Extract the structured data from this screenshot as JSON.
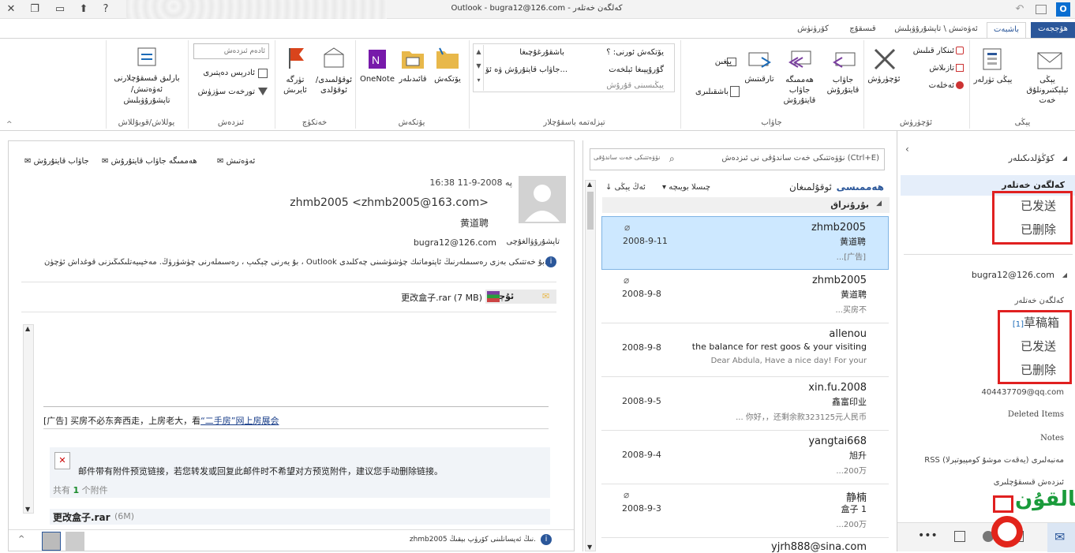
{
  "window": {
    "title": "Outlook - bugra12@126.com - كەلگەن خەتلەر",
    "close_glyph": "✕",
    "restore_glyph": "❐",
    "qa1_glyph": "▭",
    "qa2_glyph": "⬆",
    "help_glyph": "?",
    "undo_glyph": "↶",
    "app_icon": "O"
  },
  "ribbon_tabs": [
    {
      "label": "ھۆججەت"
    },
    {
      "label": "باشبەت"
    },
    {
      "label": "ئەۋەتىش \\ تاپشۇرۇۋېلىش"
    },
    {
      "label": "قىسقۇچ"
    },
    {
      "label": "كۆرۈنۈش"
    }
  ],
  "ribbon": {
    "new_email": "يېڭى ئېلېكتىرونلۇق خەت",
    "new_items": "يېڭى تۈرلەر",
    "group_new": "يېڭى",
    "ignore": "ئىنكار قىلىش",
    "cleanup": "تازىلاش",
    "junk": "ئەخلەت",
    "delete": "ئۆچۈرۈش",
    "group_delete": "ئۆچۈرۈش",
    "reply": "جاۋاب قايتۇرۇش",
    "reply_all": "ھەممىگە جاۋاب قايتۇرۇش",
    "forward": "تارقىتىش",
    "meeting": "يىغىن",
    "more": "باشقىلىرى",
    "group_respond": "جاۋاب",
    "qs1": "يۆتكەش ئورنى: ؟",
    "qs2": "باشقۇرغۇچىغا",
    "qs3": "گۇرۇپپىغا ئېلخەت",
    "qs4": "جاۋاب قايتۇرۇش ۋە ئۆ...",
    "qs5": "يېڭىسىنى قۇرۇش",
    "group_quicksteps": "تېزلەتمە باسقۇچلار",
    "move": "يۆتكەش",
    "rules": "قائىدىلەر",
    "onenote": "OneNote",
    "group_move": "يۆتكەش",
    "unread": "ئوقۇلمىدى/ ئوقۇلدى",
    "categorize": "تۈرگە ئايرىش",
    "followup": "ئەگىشىش",
    "group_tags": "خەتكۈچ",
    "search_people_placeholder": "ئادەم ئىزدەش",
    "address_book": "ئادرېس دەپتىرى",
    "filter_email": "تورخەت سۈزۈش",
    "group_find": "ئىزدەش",
    "send_receive_all": "بارلىق قىسقۇچلارنى ئەۋەتىش/تاپشۇرۇۋېلىش",
    "group_send_receive": "يوللاش/قوبۇللاش"
  },
  "nav": {
    "favorites_header": "كۆڭۈلدىكىلەر",
    "fav_inbox": "كەلگەن خەتلەر",
    "fav_sent": "已发送",
    "fav_deleted": "已删除",
    "account": "bugra12@126.com",
    "acct_inbox": "كەلگەن خەتلەر",
    "drafts": "草稿箱",
    "drafts_count": "[1]",
    "sent": "已发送",
    "deleted": "已删除",
    "qq": "404437709@qq.com",
    "deleted_items": "Deleted Items",
    "notes": "Notes",
    "rss": "RSS مەنبەلىرى (يەقەت موشۇ كومپيوتېرلا)",
    "search_folders": "ئىزدەش قىسقۇچلىرى",
    "collapse_glyph": "‹"
  },
  "list": {
    "search_placeholder": "نۆۋەتتىكى خەت ساندۇقى نى ئىزدەش (Ctrl+E)",
    "scope": "نۆۋەتتىكى خەت ساندۇقى",
    "filter_all": "ھەممىسى",
    "filter_unread": "ئوقۇلمىغان",
    "sort_by": "چىسلا بويىچە",
    "sort_order": "ئەڭ يېڭى",
    "group_header": "بۇرۇنراق",
    "messages": [
      {
        "sender": "zhmb2005",
        "subject": "黄道聘",
        "preview": "...[广告]",
        "date": "2008-9-11",
        "attach": true
      },
      {
        "sender": "zhmb2005",
        "subject": "黄道聘",
        "preview": "...买房不",
        "date": "2008-9-8",
        "attach": true
      },
      {
        "sender": "allenou",
        "subject": "the balance for rest goos & your visiting",
        "preview": "Dear Abdula,  Have a nice day!  For your",
        "date": "2008-9-8",
        "attach": false
      },
      {
        "sender": "xin.fu.2008",
        "subject": "鑫富印业",
        "preview": "... 你好，，还剩余款323125元人民币",
        "date": "2008-9-5",
        "attach": false
      },
      {
        "sender": "yangtai668",
        "subject": "旭升",
        "preview": "...200万",
        "date": "2008-9-4",
        "attach": false
      },
      {
        "sender": "静楠",
        "subject": "盒子 1",
        "preview": "...200万",
        "date": "2008-9-3",
        "attach": true
      },
      {
        "sender": "yjrh888@sina.com",
        "subject": "",
        "preview": "",
        "date": "",
        "attach": false
      }
    ]
  },
  "reading": {
    "reply": "جاۋاب قايتۇرۇش",
    "reply_all": "ھەممىگە جاۋاب قايتۇرۇش",
    "forward": "ئەۋەتىش",
    "date": "پە 2008-9-11 16:38",
    "from": "zhmb2005 <zhmb2005@163.com>",
    "subject": "黄道聘",
    "to_label": "تاپشۇرۇۋالغۇچى",
    "to": "bugra12@126.com",
    "info": "بۇ يەرنى چېكىپ ، رەسىملەرنى چۈشۈرۈڭ. مەخپىيەتلىكىڭىزنى قوغداش ئۈچۈن ، Outlook بۇ خەتتىكى بەزى رەسىملەرنىڭ ئاپتوماتىك چۈشۈشىنى چەكلىدى.",
    "msg_tab": "ئۇچۇر",
    "attachment": "更改盒子.rar (7 MB)",
    "ad_line_prefix": "[广告] 买房不必东奔西走，上房老大，看",
    "ad_link": "“二手房”网上房展会",
    "notice": "邮件带有附件预览链接，若您转发或回复此邮件时不希望对方预览附件，建议您手动删除链接。",
    "count_prefix": "共有",
    "count_num": "1",
    "count_suffix": "个附件",
    "file_name": "更改盒子.rar",
    "file_size": "(6M)",
    "people_pane": "zhmb2005 نىڭ ئەپسانلىنى كۆرۈپ بېقىڭ."
  },
  "logo_text": "بالقۇن",
  "colors": {
    "accent": "#2b579a",
    "selection": "#cde8ff",
    "redbox": "#e02020",
    "logo_green": "#1a9b3b"
  }
}
